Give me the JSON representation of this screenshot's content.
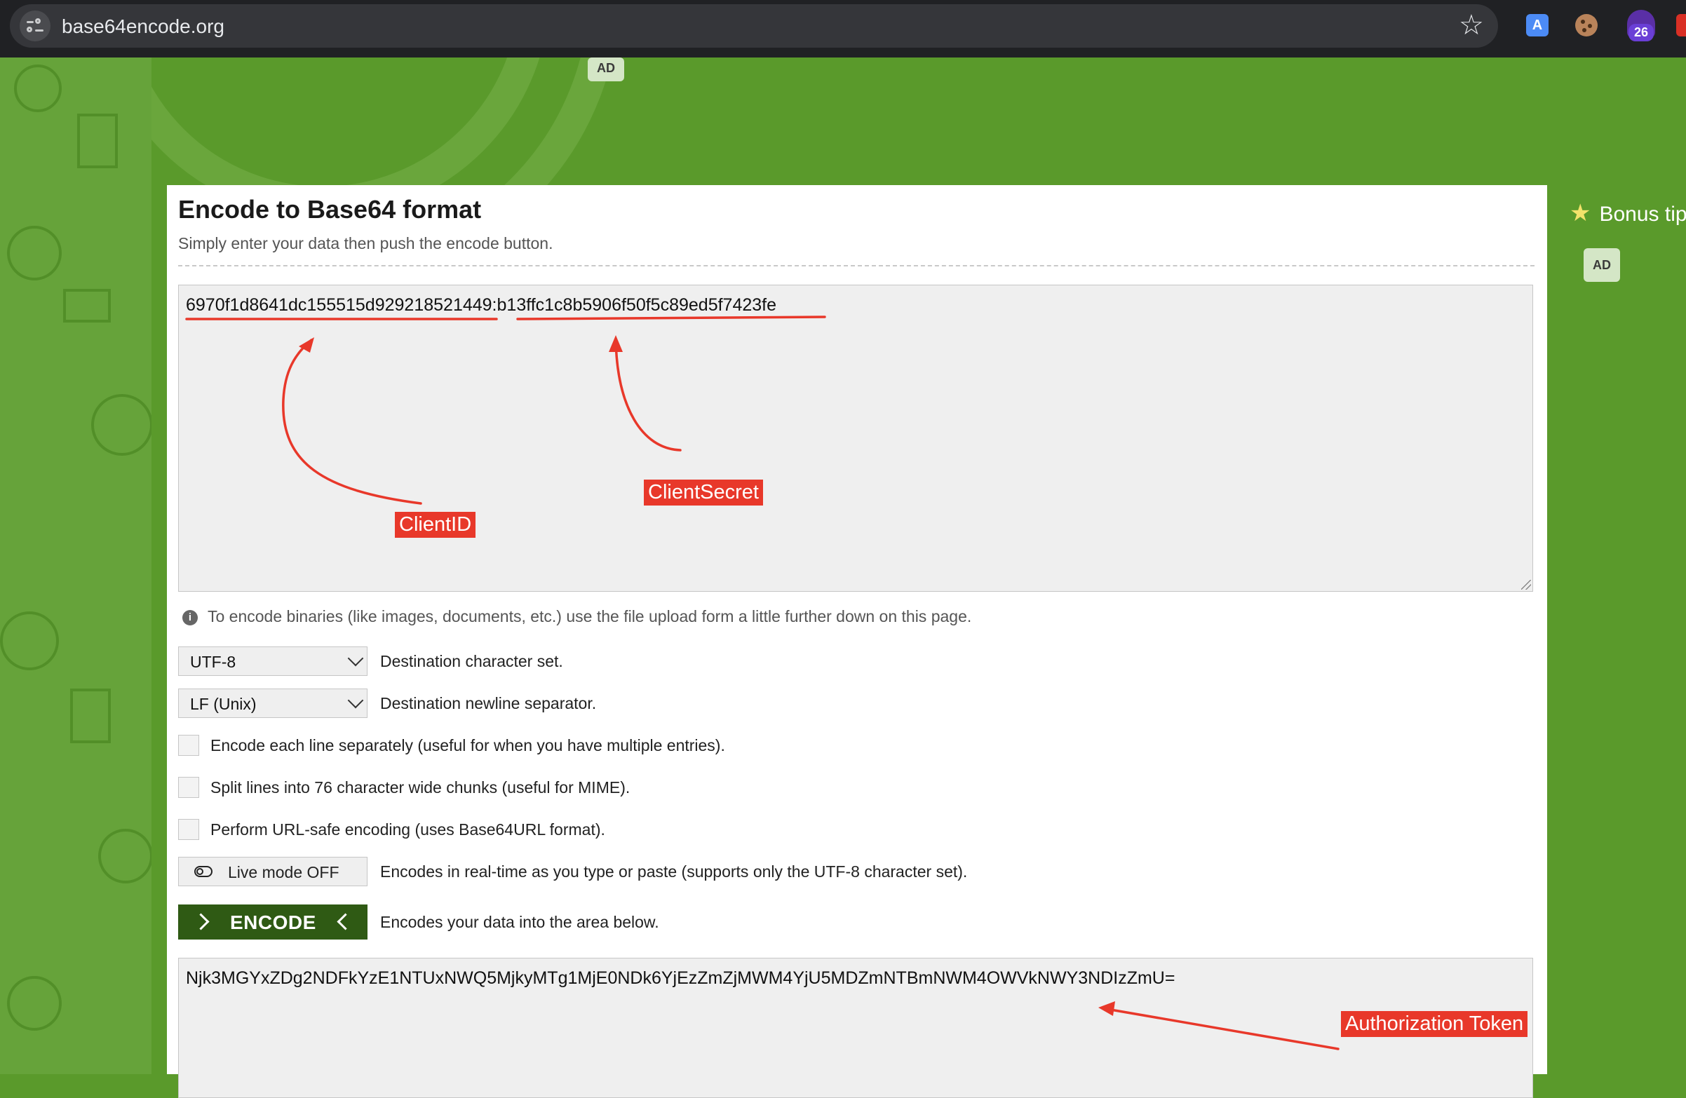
{
  "browser": {
    "url": "base64encode.org",
    "extension_badge": "26",
    "translate_icon": "A"
  },
  "ads": {
    "top_label": "AD",
    "side_label": "AD"
  },
  "page": {
    "title": "Encode to Base64 format",
    "subtitle": "Simply enter your data then push the encode button.",
    "input_value": "6970f1d8641dc155515d929218521449:b13ffc1c8b5906f50f5c89ed5f7423fe",
    "info_icon": "i",
    "info_text": "To encode binaries (like images, documents, etc.) use the file upload form a little further down on this page.",
    "charset": {
      "value": "UTF-8",
      "label": "Destination character set."
    },
    "newline": {
      "value": "LF (Unix)",
      "label": "Destination newline separator."
    },
    "options": [
      "Encode each line separately (useful for when you have multiple entries).",
      "Split lines into 76 character wide chunks (useful for MIME).",
      "Perform URL-safe encoding (uses Base64URL format)."
    ],
    "live_mode": {
      "label": "Live mode OFF",
      "description": "Encodes in real-time as you type or paste (supports only the UTF-8 character set)."
    },
    "encode": {
      "label": "ENCODE",
      "description": "Encodes your data into the area below."
    },
    "output_value": "Njk3MGYxZDg2NDFkYzE1NTUxNWQ5MjkyMTg1MjE0NDk6YjEzZmZjMWM4YjU5MDZmNTBmNWM4OWVkNWY3NDIzZmU="
  },
  "sidebar": {
    "bonus_label": "Bonus tip"
  },
  "annotations": {
    "client_id": "ClientID",
    "client_secret": "ClientSecret",
    "auth_token": "Authorization Token",
    "color": "#e8382a"
  }
}
